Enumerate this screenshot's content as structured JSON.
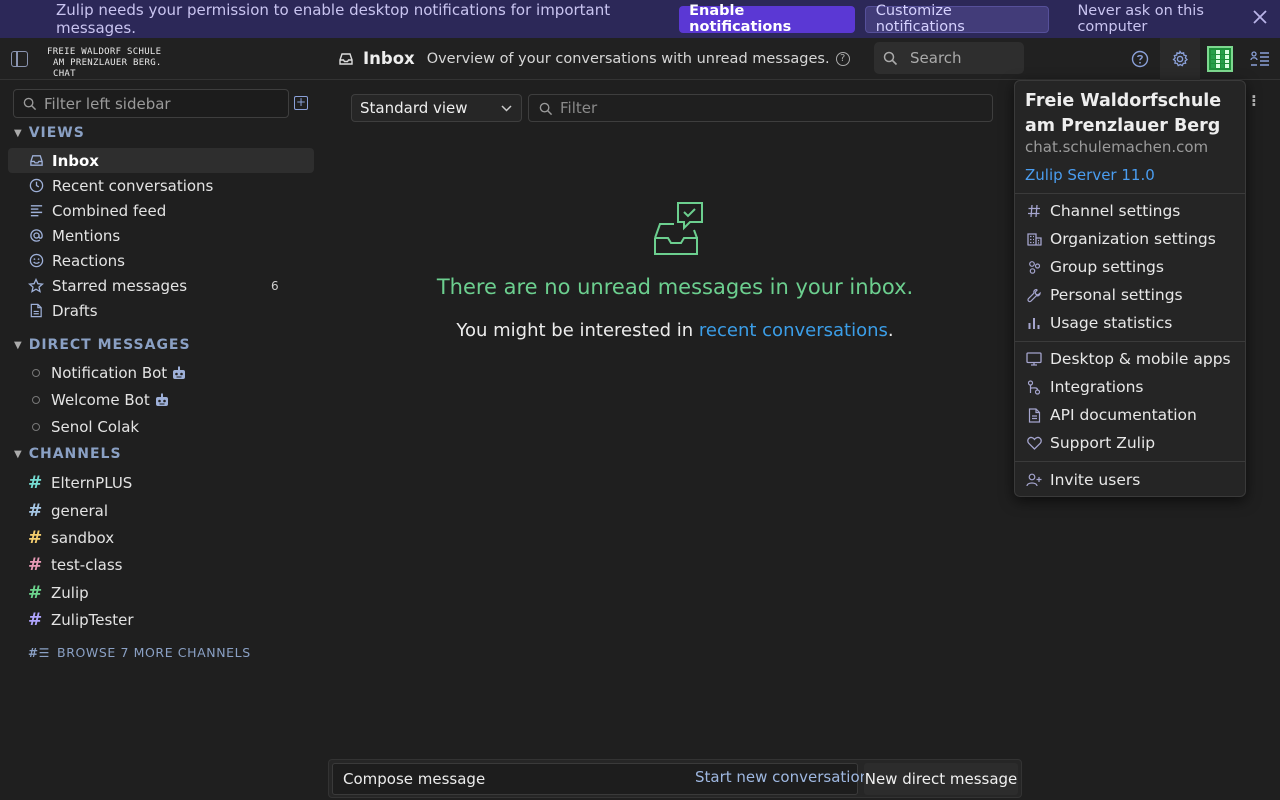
{
  "banner": {
    "text": "Zulip needs your permission to enable desktop notifications for important messages.",
    "enable": "Enable notifications",
    "customize": "Customize notifications",
    "never": "Never ask on this computer",
    "close_icon": "close-icon"
  },
  "header": {
    "org_line1": "FREIE WALDORF SCHULE",
    "org_line2": "AM PRENZLAUER BERG. CHAT",
    "title": "Inbox",
    "description": "Overview of your conversations with unread messages.",
    "search_placeholder": "Search",
    "help_mark": "?"
  },
  "sidebar": {
    "filter_placeholder": "Filter left sidebar",
    "views_header": "VIEWS",
    "views": [
      {
        "label": "Inbox",
        "icon": "inbox-icon"
      },
      {
        "label": "Recent conversations",
        "icon": "clock-icon"
      },
      {
        "label": "Combined feed",
        "icon": "feed-icon"
      },
      {
        "label": "Mentions",
        "icon": "at-icon"
      },
      {
        "label": "Reactions",
        "icon": "smiley-icon"
      },
      {
        "label": "Starred messages",
        "icon": "star-icon",
        "count": "6"
      },
      {
        "label": "Drafts",
        "icon": "draft-icon"
      }
    ],
    "dm_header": "DIRECT MESSAGES",
    "dms": [
      {
        "label": "Notification Bot"
      },
      {
        "label": "Welcome Bot"
      },
      {
        "label": "Senol Colak"
      }
    ],
    "channels_header": "CHANNELS",
    "channels": [
      {
        "label": "ElternPLUS",
        "color": "#76ddd3"
      },
      {
        "label": "general",
        "color": "#a6c7e5"
      },
      {
        "label": "sandbox",
        "color": "#f5ce6e"
      },
      {
        "label": "test-class",
        "color": "#e79ab5"
      },
      {
        "label": "Zulip",
        "color": "#6cd48d"
      },
      {
        "label": "ZulipTester",
        "color": "#b0a5fd"
      }
    ],
    "browse": "BROWSE 7 MORE CHANNELS"
  },
  "main": {
    "view_select": "Standard view",
    "filter_placeholder": "Filter",
    "empty_title": "There are no unread messages in your inbox.",
    "empty_sub_before": "You might be interested in ",
    "empty_sub_link": "recent conversations",
    "empty_sub_after": "."
  },
  "compose": {
    "compose_label": "Compose message",
    "start_new": "Start new conversation",
    "new_dm": "New direct message"
  },
  "popover": {
    "org_name": "Freie Waldorfschule am Prenzlauer Berg",
    "url": "chat.schulemachen.com",
    "server": "Zulip Server 11.0",
    "group1": [
      {
        "label": "Channel settings",
        "icon": "hash-icon"
      },
      {
        "label": "Organization settings",
        "icon": "building-icon"
      },
      {
        "label": "Group settings",
        "icon": "group-icon"
      },
      {
        "label": "Personal settings",
        "icon": "wrench-icon"
      },
      {
        "label": "Usage statistics",
        "icon": "bar-chart-icon"
      }
    ],
    "group2": [
      {
        "label": "Desktop & mobile apps",
        "icon": "monitor-icon"
      },
      {
        "label": "Integrations",
        "icon": "integrations-icon"
      },
      {
        "label": "API documentation",
        "icon": "document-icon"
      },
      {
        "label": "Support Zulip",
        "icon": "heart-icon"
      }
    ],
    "group3": [
      {
        "label": "Invite users",
        "icon": "user-plus-icon"
      }
    ]
  },
  "colors": {
    "accent": "#5b38d4",
    "banner_bg": "#2c2858",
    "success": "#6ccf8f",
    "link": "#3b9ee8"
  }
}
